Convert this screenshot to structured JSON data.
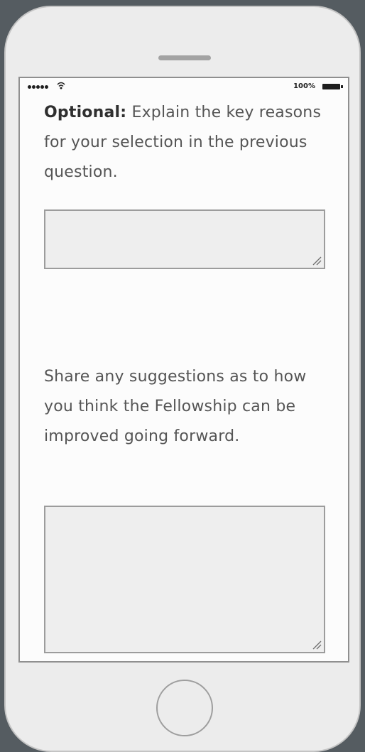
{
  "status_bar": {
    "battery_text": "100%",
    "signal_icon": "signal-dots-icon",
    "wifi_icon": "wifi-icon",
    "battery_icon": "battery-icon"
  },
  "questions": [
    {
      "label_bold": "Optional:",
      "label_text": " Explain the key reasons for your selection in the previous question.",
      "answer_value": ""
    },
    {
      "label_text": "Share any suggestions as to how you think the Fellowship can be improved going forward.",
      "answer_value": ""
    }
  ],
  "colors": {
    "device_body": "#ececec",
    "screen": "#fcfcfc",
    "field": "#eeeeee",
    "text": "#555555"
  }
}
